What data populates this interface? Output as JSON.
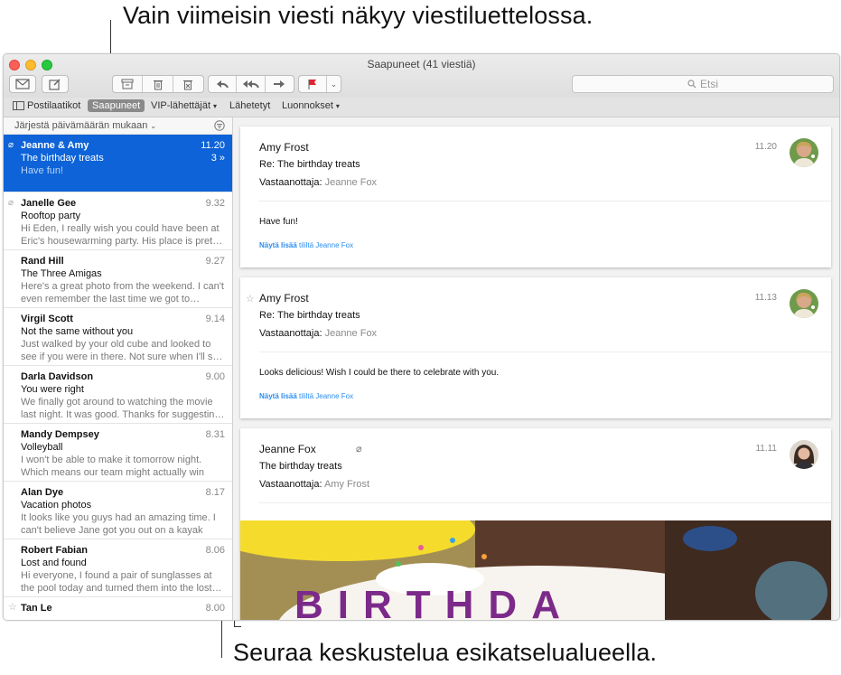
{
  "callouts": {
    "top": "Vain viimeisin viesti näkyy viestiluettelossa.",
    "bottom": "Seuraa keskustelua esikatselualueella."
  },
  "window": {
    "title": "Saapuneet (41 viestiä)",
    "search_placeholder": "Etsi"
  },
  "favorites": {
    "mailboxes": "Postilaatikot",
    "inbox": "Saapuneet",
    "vip": "VIP-lähettäjät",
    "sent": "Lähetetyt",
    "drafts": "Luonnokset"
  },
  "list": {
    "sort_label": "Järjestä päivämäärän mukaan",
    "messages": [
      {
        "sender": "Jeanne & Amy",
        "date": "11.20",
        "subject": "The birthday treats",
        "preview": "Have fun!",
        "thread": "3 »"
      },
      {
        "sender": "Janelle Gee",
        "date": "9.32",
        "subject": "Rooftop party",
        "preview": "Hi Eden, I really wish you could have been at Eric's housewarming party. His place is pret…"
      },
      {
        "sender": "Rand Hill",
        "date": "9.27",
        "subject": "The Three Amigas",
        "preview": "Here's a great photo from the weekend. I can't even remember the last time we got to…"
      },
      {
        "sender": "Virgil Scott",
        "date": "9.14",
        "subject": "Not the same without you",
        "preview": "Just walked by your old cube and looked to see if you were in there. Not sure when I'll s…"
      },
      {
        "sender": "Darla Davidson",
        "date": "9.00",
        "subject": "You were right",
        "preview": "We finally got around to watching the movie last night. It was good. Thanks for suggestin…"
      },
      {
        "sender": "Mandy Dempsey",
        "date": "8.31",
        "subject": "Volleyball",
        "preview": "I won't be able to make it tomorrow night. Which means our team might actually win"
      },
      {
        "sender": "Alan Dye",
        "date": "8.17",
        "subject": "Vacation photos",
        "preview": "It looks like you guys had an amazing time. I can't believe Jane got you out on a kayak"
      },
      {
        "sender": "Robert Fabian",
        "date": "8.06",
        "subject": "Lost and found",
        "preview": "Hi everyone, I found a pair of sunglasses at the pool today and turned them into the lost…"
      },
      {
        "sender": "Tan Le",
        "date": "8.00",
        "subject": "",
        "preview": ""
      }
    ]
  },
  "conversation": {
    "to_label": "Vastaanottaja:",
    "more_label": "Näytä lisää",
    "more_suffix": "tililtä Jeanne Fox",
    "cards": [
      {
        "from": "Amy Frost",
        "subject": "Re: The birthday treats",
        "to": "Jeanne Fox",
        "date": "11.20",
        "body": "Have fun!"
      },
      {
        "from": "Amy Frost",
        "subject": "Re: The birthday treats",
        "to": "Jeanne Fox",
        "date": "11.13",
        "body": "Looks delicious! Wish I could be there to celebrate with you."
      },
      {
        "from": "Jeanne Fox",
        "subject": "The birthday treats",
        "to": "Amy Frost",
        "date": "11.11",
        "image_text": "BIRTHDA"
      }
    ]
  },
  "colors": {
    "selection": "#0d63d7",
    "link": "#2b8df0",
    "flag": "#e0232f"
  }
}
